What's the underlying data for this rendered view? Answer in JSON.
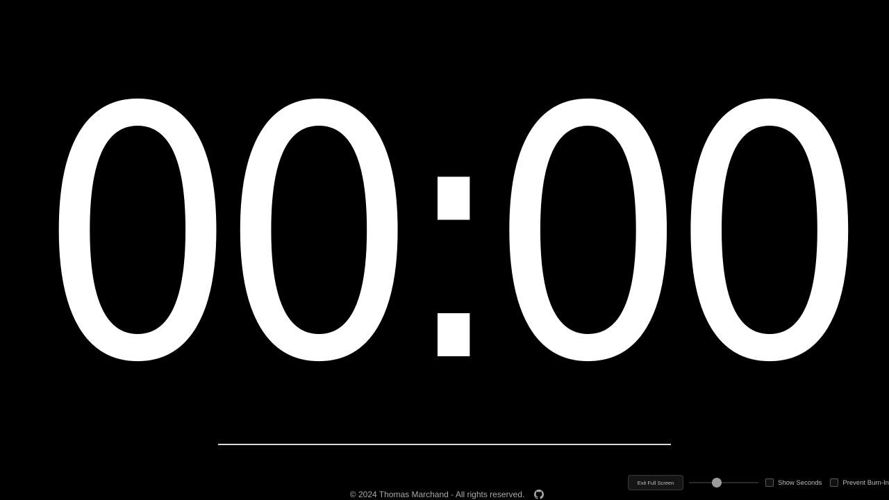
{
  "clock": {
    "time": "00:00"
  },
  "controls": {
    "exit_fullscreen_label": "Exit Full Screen",
    "slider_value": 0.4,
    "show_seconds_label": "Show Seconds",
    "show_seconds_checked": false,
    "prevent_burn_in_label": "Prevent Burn-In",
    "prevent_burn_in_checked": false
  },
  "footer": {
    "copyright": "© 2024 Thomas Marchand - All rights reserved.",
    "icon": "github-icon"
  },
  "colors": {
    "background": "#000000",
    "clock": "#ffffff",
    "divider": "#d9d9d9",
    "muted_text": "#a8a8a8"
  }
}
